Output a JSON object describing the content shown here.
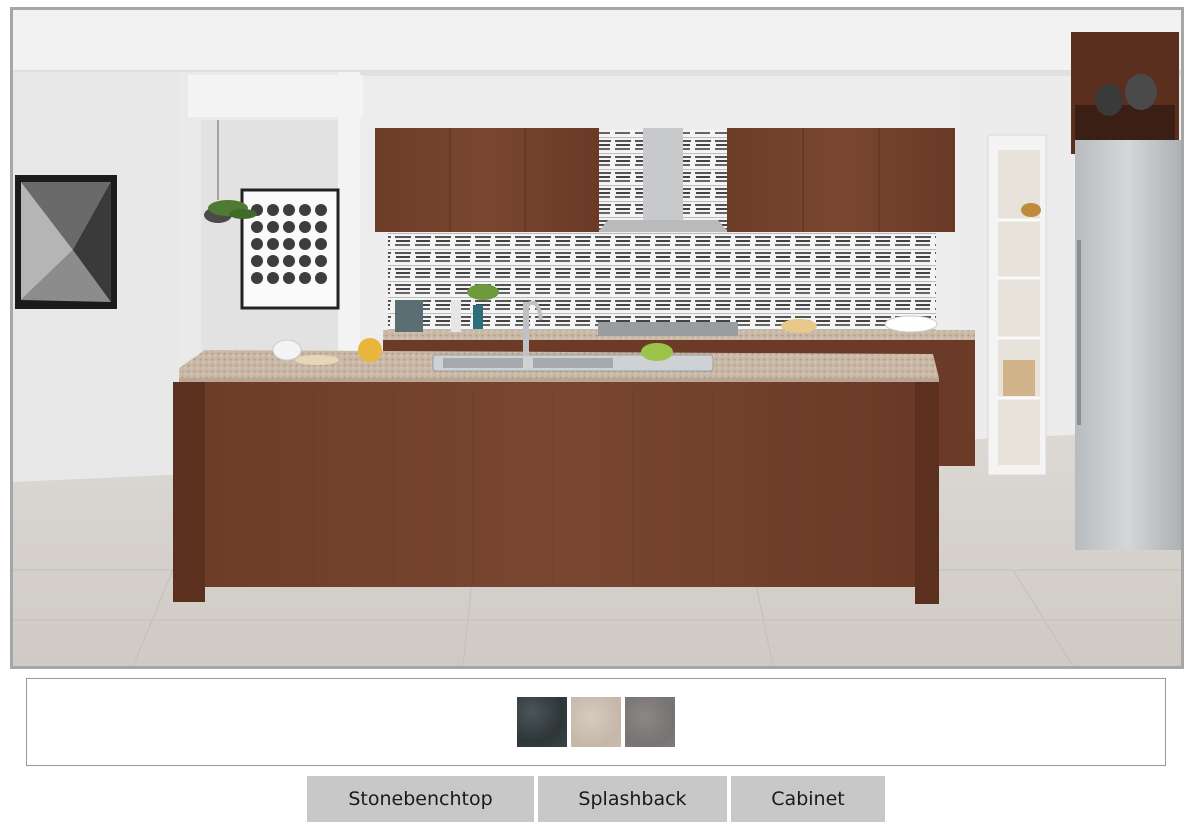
{
  "scene": {
    "name": "kitchen render"
  },
  "swatches": [
    {
      "name": "dark stone",
      "color": "#343d40"
    },
    {
      "name": "beige stone",
      "color": "#c8bbad"
    },
    {
      "name": "grey stone",
      "color": "#7b7877"
    }
  ],
  "buttons": {
    "stonebenchtop": "Stonebenchtop",
    "splashback": "Splashback",
    "cabinet": "Cabinet"
  }
}
